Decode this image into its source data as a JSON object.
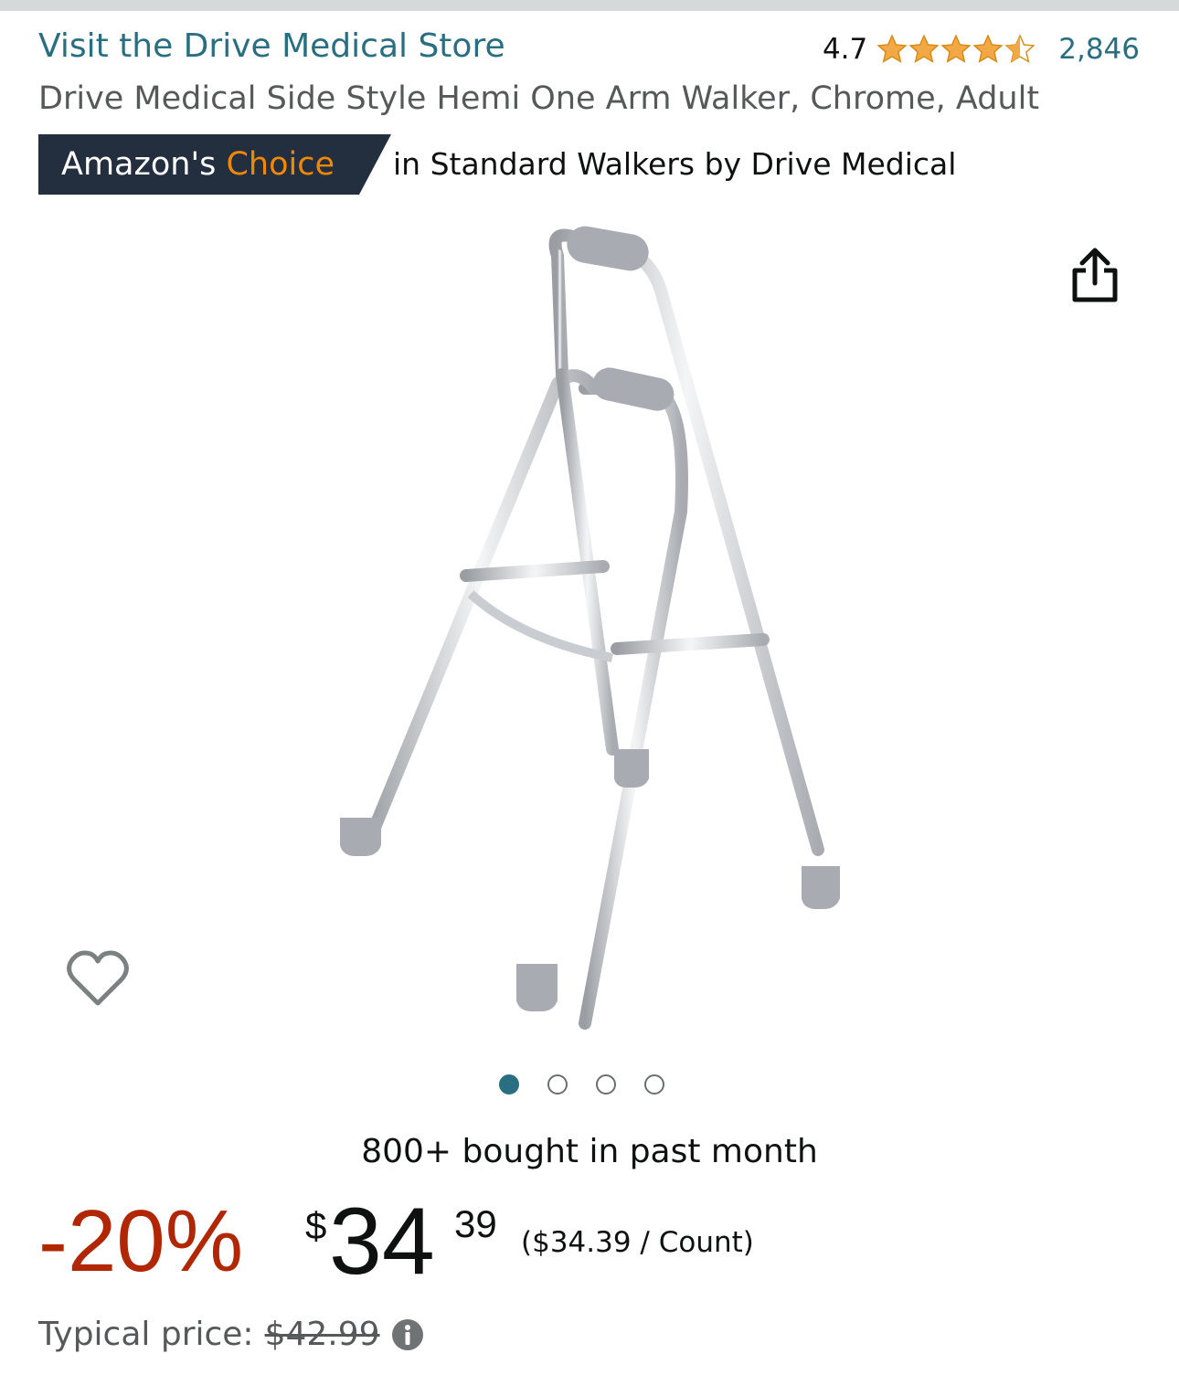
{
  "store": {
    "link_text": "Visit the Drive Medical Store"
  },
  "rating": {
    "value": "4.7",
    "stars": 4.7,
    "review_count": "2,846",
    "star_color": "#f3a847"
  },
  "product": {
    "title": "Drive Medical Side Style Hemi One Arm Walker, Chrome, Adult"
  },
  "badge": {
    "prefix": "Amazon's",
    "accent": "Choice",
    "context": "in Standard Walkers by Drive Medical"
  },
  "gallery": {
    "image_icon": "walker-product-image",
    "total_images": 4,
    "active_index": 0
  },
  "social": {
    "bought_text": "800+ bought in past month"
  },
  "price": {
    "discount": "-20%",
    "currency": "$",
    "whole": "34",
    "fraction": "39",
    "unit_price": "($34.39 / Count)",
    "typical_label": "Typical price:",
    "typical_value": "$42.99"
  },
  "icons": {
    "share": "share-icon",
    "wishlist": "heart-icon",
    "info": "info-icon"
  },
  "colors": {
    "link": "#2a6f81",
    "discount": "#b12704",
    "badge_bg": "#232f3e",
    "badge_accent": "#f08804"
  }
}
